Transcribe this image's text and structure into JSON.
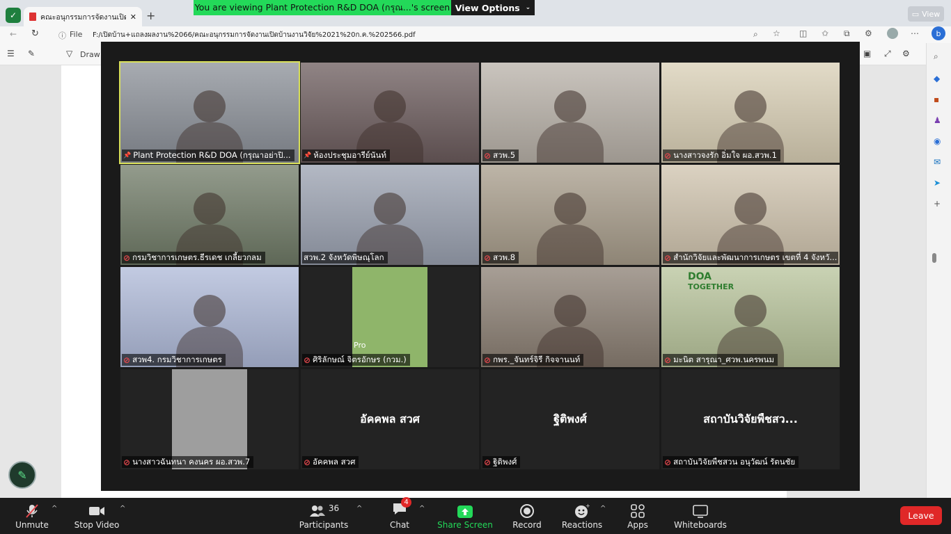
{
  "browser": {
    "tab_title": "คณะอนุกรรมการจัดงานเปิดบ้านงานวิจัย",
    "address": "F:/เปิดบ้าน+แถลงผลงาน%2066/คณะอนุกรรมการจัดงานเปิดบ้านงานวิจัย%2021%20ก.ค.%202566.pdf",
    "file_label": "File",
    "draw_label": "Draw",
    "view_label": "View"
  },
  "share_banner": {
    "message": "You are viewing Plant Protection R&D DOA (กรุณ...'s screen",
    "options_label": "View Options"
  },
  "participants_grid": [
    {
      "name": "Plant Protection R&D DOA (กรุณาอย่าปิ...",
      "muted": false,
      "pinned": true,
      "bg": "#8a8f97"
    },
    {
      "name": "ห้องประชุมอารีย์นันท์",
      "muted": false,
      "pinned": true,
      "bg": "#6b5b5c"
    },
    {
      "name": "สวพ.5",
      "muted": true,
      "pinned": false,
      "bg": "#b8b1a8"
    },
    {
      "name": "นางสาวจงรัก  อิ่มใจ ผอ.สวพ.1",
      "muted": true,
      "pinned": false,
      "bg": "#d9cfb5"
    },
    {
      "name": "กรมวิชาการเกษตร.ธีรเดช เกลี้ยวกลม",
      "muted": true,
      "pinned": false,
      "bg": "#6f7a66"
    },
    {
      "name": "สวพ.2 จังหวัดพิษณุโลก",
      "muted": false,
      "pinned": false,
      "bg": "#9aa1b0"
    },
    {
      "name": "สวพ.8",
      "muted": true,
      "pinned": false,
      "bg": "#a79c8a"
    },
    {
      "name": "สำนักวิจัยและพัฒนาการเกษตร เขตที่ 4 จังหวั...",
      "muted": true,
      "pinned": false,
      "bg": "#cfc3ad"
    },
    {
      "name": "สวพ4. กรมวิชาการเกษตร",
      "muted": true,
      "pinned": false,
      "bg": "#aeb9d8"
    },
    {
      "name": "ศิริลักษณ์ จิตรอักษร (กวม.)",
      "muted": true,
      "pinned": false,
      "bg": "#8fb56a"
    },
    {
      "name": "กพร._จันทร์จิรี กิจจานนท์",
      "muted": true,
      "pinned": false,
      "bg": "#8a7e72"
    },
    {
      "name": "มะนิต สารุณา_ศวพ.นครพนม",
      "muted": true,
      "pinned": false,
      "bg": "#b7c39a"
    },
    {
      "name": "นางสาวฉันทนา คงนคร ผอ.สวพ.7",
      "muted": true,
      "pinned": false,
      "bg": "#9e9e9e"
    },
    {
      "name": "อัคคพล สวศ",
      "muted": true,
      "pinned": false,
      "bg": "#232323",
      "display": "อัคคพล สวศ"
    },
    {
      "name": "ฐิติพงศ์",
      "muted": true,
      "pinned": false,
      "bg": "#232323",
      "display": "ฐิติพงศ์"
    },
    {
      "name": "สถาบันวิจัยพืชสวน อนุวัฒน์ รัตนชัย",
      "muted": true,
      "pinned": false,
      "bg": "#232323",
      "display": "สถาบันวิจัยพืชสว..."
    }
  ],
  "tile_text": {
    "doa_logo": "DOA",
    "doa_sub": "TOGETHER",
    "pro_label": "Pro"
  },
  "toolbar": {
    "unmute": "Unmute",
    "stop_video": "Stop Video",
    "participants": "Participants",
    "participants_count": "36",
    "chat": "Chat",
    "chat_badge": "4",
    "share_screen": "Share Screen",
    "record": "Record",
    "reactions": "Reactions",
    "apps": "Apps",
    "whiteboards": "Whiteboards",
    "leave": "Leave"
  },
  "colors": {
    "share_green": "#23d959",
    "leave_red": "#e02828",
    "mute_red": "#e5484d"
  }
}
